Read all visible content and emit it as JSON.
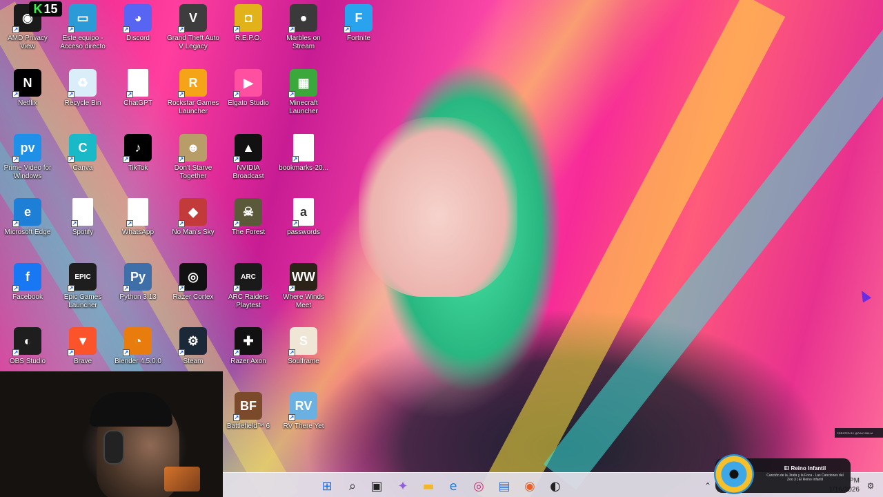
{
  "desktop": {
    "icons": [
      {
        "label": "AMD Privacy View",
        "icon": "amd-privacy-view-icon",
        "color": "#1a1a1a",
        "glyph": "◉"
      },
      {
        "label": "Este equipo - Acceso directo",
        "icon": "computer-icon",
        "color": "#2b9bd8",
        "glyph": "▭"
      },
      {
        "label": "Discord",
        "icon": "discord-icon",
        "color": "#5865f2",
        "glyph": "◕"
      },
      {
        "label": "Grand Theft Auto V Legacy",
        "icon": "gta-v-icon",
        "color": "#3d3d3d",
        "glyph": "V"
      },
      {
        "label": "R.E.P.O.",
        "icon": "repo-icon",
        "color": "#e2b21b",
        "glyph": "◘"
      },
      {
        "label": "Marbles on Stream",
        "icon": "marbles-icon",
        "color": "#3a3a3a",
        "glyph": "●"
      },
      {
        "label": "Fortnite",
        "icon": "fortnite-icon",
        "color": "#2aa3ee",
        "glyph": "F"
      },
      {
        "label": "Netflix",
        "icon": "netflix-icon",
        "color": "#000000",
        "glyph": "N"
      },
      {
        "label": "Recycle Bin",
        "icon": "recycle-bin-icon",
        "color": "#d9eef8",
        "glyph": "♻"
      },
      {
        "label": "ChatGPT",
        "icon": "chatgpt-file-icon",
        "color": "#ffffff",
        "glyph": ""
      },
      {
        "label": "Rockstar Games Launcher",
        "icon": "rockstar-icon",
        "color": "#f5a418",
        "glyph": "R"
      },
      {
        "label": "Elgato Studio",
        "icon": "elgato-icon",
        "color": "#ff4fa0",
        "glyph": "▶"
      },
      {
        "label": "Minecraft Launcher",
        "icon": "minecraft-icon",
        "color": "#3aa83a",
        "glyph": "▦"
      },
      {
        "label": "Prime Video for Windows",
        "icon": "prime-video-icon",
        "color": "#1e90e8",
        "glyph": "pv"
      },
      {
        "label": "Canva",
        "icon": "canva-icon",
        "color": "#19b9c8",
        "glyph": "C"
      },
      {
        "label": "TikTok",
        "icon": "tiktok-icon",
        "color": "#000000",
        "glyph": "♪"
      },
      {
        "label": "Don't Starve Together",
        "icon": "dont-starve-icon",
        "color": "#b89d68",
        "glyph": "☻"
      },
      {
        "label": "NVIDIA Broadcast",
        "icon": "nvidia-broadcast-icon",
        "color": "#111111",
        "glyph": "▲"
      },
      {
        "label": "bookmarks-20...",
        "icon": "bookmarks-file-icon",
        "color": "#ffffff",
        "glyph": ""
      },
      {
        "label": "Microsoft Edge",
        "icon": "edge-icon",
        "color": "#1e7fd6",
        "glyph": "e"
      },
      {
        "label": "Spotify",
        "icon": "spotify-file-icon",
        "color": "#ffffff",
        "glyph": ""
      },
      {
        "label": "WhatsApp",
        "icon": "whatsapp-file-icon",
        "color": "#ffffff",
        "glyph": ""
      },
      {
        "label": "No Man's Sky",
        "icon": "no-mans-sky-icon",
        "color": "#c23a3a",
        "glyph": "◆"
      },
      {
        "label": "The Forest",
        "icon": "the-forest-icon",
        "color": "#5a5a3a",
        "glyph": "☠"
      },
      {
        "label": "passwords",
        "icon": "passwords-file-icon",
        "color": "#ffffff",
        "glyph": "a"
      },
      {
        "label": "Facebook",
        "icon": "facebook-icon",
        "color": "#1877f2",
        "glyph": "f"
      },
      {
        "label": "Epic Games Launcher",
        "icon": "epic-games-icon",
        "color": "#1e1e1e",
        "glyph": "EPIC"
      },
      {
        "label": "Python 3.13",
        "icon": "python-icon",
        "color": "#3e6fa8",
        "glyph": "Py"
      },
      {
        "label": "Razer Cortex",
        "icon": "razer-cortex-icon",
        "color": "#111111",
        "glyph": "◎"
      },
      {
        "label": "ARC Raiders Playtest",
        "icon": "arc-raiders-icon",
        "color": "#1a1a1a",
        "glyph": "ARC"
      },
      {
        "label": "Where Winds Meet",
        "icon": "where-winds-meet-icon",
        "color": "#2b2218",
        "glyph": "WW"
      },
      {
        "label": "OBS Studio",
        "icon": "obs-icon",
        "color": "#1e1e1e",
        "glyph": "◐"
      },
      {
        "label": "Brave",
        "icon": "brave-icon",
        "color": "#fb542b",
        "glyph": "▼"
      },
      {
        "label": "Blender 4.5.0.0",
        "icon": "blender-icon",
        "color": "#e87d0d",
        "glyph": "◔"
      },
      {
        "label": "Steam",
        "icon": "steam-icon",
        "color": "#1b2838",
        "glyph": "⚙"
      },
      {
        "label": "Razer Axon",
        "icon": "razer-axon-icon",
        "color": "#111111",
        "glyph": "✚"
      },
      {
        "label": "Soulframe",
        "icon": "soulframe-icon",
        "color": "#efe6d6",
        "glyph": "S"
      },
      {
        "label": "Battlefield™ 6",
        "icon": "battlefield-icon",
        "color": "#7a4a2a",
        "glyph": "BF"
      },
      {
        "label": "RV There Yet",
        "icon": "rv-there-yet-icon",
        "color": "#6ab0e0",
        "glyph": "RV"
      }
    ]
  },
  "overlay": {
    "badge_letter": "K",
    "badge_number": "15",
    "credit": "CREATED BY @DAX1266 AI"
  },
  "media": {
    "title": "El Reino Infantil",
    "subtitle": "Canción de la Jirafa y la Foca - Las Canciones del Zoo 3 | El Reino Infantil"
  },
  "taskbar": {
    "items": [
      {
        "name": "start-button",
        "icon": "windows-icon",
        "color": "#1a73e8"
      },
      {
        "name": "search-button",
        "icon": "search-icon",
        "color": "#222222"
      },
      {
        "name": "task-view-button",
        "icon": "task-view-icon",
        "color": "#222222"
      },
      {
        "name": "copilot-button",
        "icon": "copilot-icon",
        "color": "#8e5ce6"
      },
      {
        "name": "file-explorer-button",
        "icon": "folder-icon",
        "color": "#f2b62b"
      },
      {
        "name": "edge-taskbar-button",
        "icon": "edge-icon",
        "color": "#1e7fd6"
      },
      {
        "name": "instagram-button",
        "icon": "instagram-icon",
        "color": "#d6307a"
      },
      {
        "name": "store-button",
        "icon": "store-icon",
        "color": "#2b6fd1"
      },
      {
        "name": "firefox-button",
        "icon": "firefox-icon",
        "color": "#e8612a"
      },
      {
        "name": "obs-taskbar-button",
        "icon": "obs-icon",
        "color": "#222222"
      }
    ],
    "time": "PM",
    "date": "1/16/2026"
  }
}
